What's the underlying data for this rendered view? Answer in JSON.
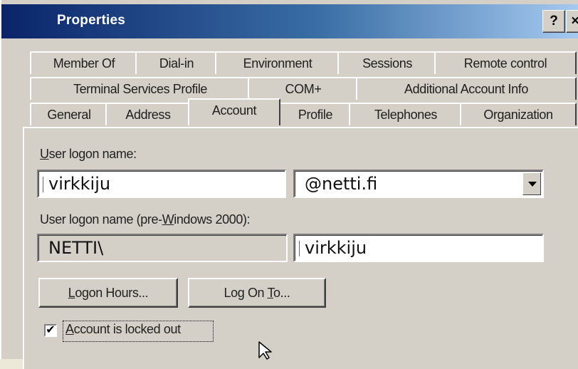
{
  "window": {
    "title": "Properties",
    "help_label": "?",
    "close_label": "×"
  },
  "tabs": {
    "row1": [
      "Member Of",
      "Dial-in",
      "Environment",
      "Sessions",
      "Remote control"
    ],
    "row2": [
      "Terminal Services Profile",
      "COM+",
      "Additional Account Info"
    ],
    "row3": [
      "General",
      "Address",
      "Account",
      "Profile",
      "Telephones",
      "Organization"
    ],
    "active": "Account"
  },
  "account": {
    "logon_name_label_u": "U",
    "logon_name_label_rest": "ser logon name:",
    "logon_name_value": "virkkiju",
    "domain_suffix": "@netti.fi",
    "pre2000_label_a": "User logon name (pre-",
    "pre2000_label_u": "W",
    "pre2000_label_b": "indows 2000):",
    "pre2000_domain": "NETTI\\",
    "pre2000_value": "virkkiju",
    "logon_hours_u": "L",
    "logon_hours_rest": "ogon Hours...",
    "logon_to_a": "Log On ",
    "logon_to_u": "T",
    "logon_to_b": "o...",
    "locked_u": "A",
    "locked_rest": "ccount is locked out",
    "locked_checked": "✔"
  }
}
